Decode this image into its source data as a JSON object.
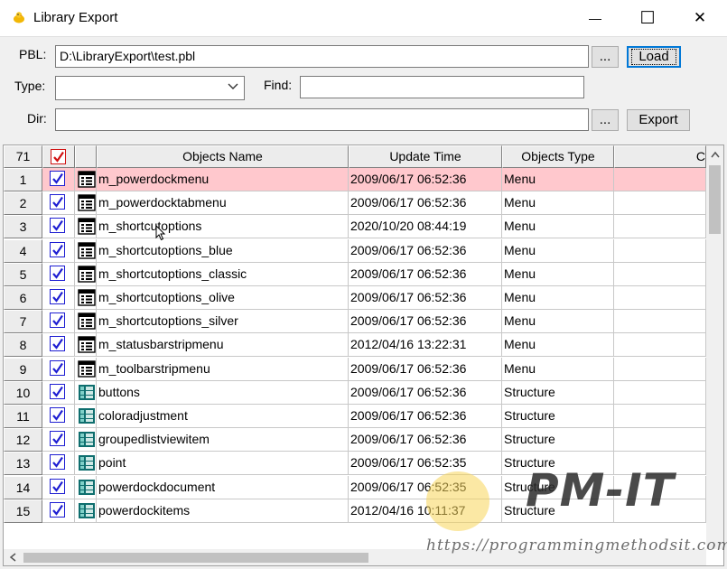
{
  "window": {
    "title": "Library Export",
    "minimize_glyph": "—",
    "maximize_glyph": "☐",
    "close_glyph": "✕"
  },
  "form": {
    "pbl_label": "PBL:",
    "pbl_value": "D:\\LibraryExport\\test.pbl",
    "browse_pbl_label": "...",
    "load_label": "Load",
    "type_label": "Type:",
    "type_value": "",
    "find_label": "Find:",
    "find_value": "",
    "dir_label": "Dir:",
    "dir_value": "",
    "browse_dir_label": "...",
    "export_label": "Export"
  },
  "grid": {
    "count": "71",
    "columns": [
      "Objects Name",
      "Update Time",
      "Objects Type",
      "C"
    ],
    "rows": [
      {
        "num": "1",
        "name": "m_powerdockmenu",
        "time": "2009/06/17 06:52:36",
        "type": "Menu",
        "icon": "menu-icon",
        "selected": true
      },
      {
        "num": "2",
        "name": "m_powerdocktabmenu",
        "time": "2009/06/17 06:52:36",
        "type": "Menu",
        "icon": "menu-icon"
      },
      {
        "num": "3",
        "name": "m_shortcutoptions",
        "time": "2020/10/20 08:44:19",
        "type": "Menu",
        "icon": "menu-icon"
      },
      {
        "num": "4",
        "name": "m_shortcutoptions_blue",
        "time": "2009/06/17 06:52:36",
        "type": "Menu",
        "icon": "menu-icon"
      },
      {
        "num": "5",
        "name": "m_shortcutoptions_classic",
        "time": "2009/06/17 06:52:36",
        "type": "Menu",
        "icon": "menu-icon"
      },
      {
        "num": "6",
        "name": "m_shortcutoptions_olive",
        "time": "2009/06/17 06:52:36",
        "type": "Menu",
        "icon": "menu-icon"
      },
      {
        "num": "7",
        "name": "m_shortcutoptions_silver",
        "time": "2009/06/17 06:52:36",
        "type": "Menu",
        "icon": "menu-icon"
      },
      {
        "num": "8",
        "name": "m_statusbarstripmenu",
        "time": "2012/04/16 13:22:31",
        "type": "Menu",
        "icon": "menu-icon"
      },
      {
        "num": "9",
        "name": "m_toolbarstripmenu",
        "time": "2009/06/17 06:52:36",
        "type": "Menu",
        "icon": "menu-icon"
      },
      {
        "num": "10",
        "name": "buttons",
        "time": "2009/06/17 06:52:36",
        "type": "Structure",
        "icon": "structure-icon"
      },
      {
        "num": "11",
        "name": "coloradjustment",
        "time": "2009/06/17 06:52:36",
        "type": "Structure",
        "icon": "structure-icon"
      },
      {
        "num": "12",
        "name": "groupedlistviewitem",
        "time": "2009/06/17 06:52:36",
        "type": "Structure",
        "icon": "structure-icon"
      },
      {
        "num": "13",
        "name": "point",
        "time": "2009/06/17 06:52:35",
        "type": "Structure",
        "icon": "structure-icon"
      },
      {
        "num": "14",
        "name": "powerdockdocument",
        "time": "2009/06/17 06:52:35",
        "type": "Structure",
        "icon": "structure-icon"
      },
      {
        "num": "15",
        "name": "powerdockitems",
        "time": "2012/04/16 10:11:37",
        "type": "Structure",
        "icon": "structure-icon"
      }
    ]
  },
  "colors": {
    "selected_row": "#ffc8cd",
    "checkbox_border": "#1e1ed2",
    "header_check": "#d01010",
    "structure_icon": "#0e6e6e"
  },
  "watermark": {
    "logo": "PM-IT",
    "url": "https://programmingmethodsit.com"
  }
}
